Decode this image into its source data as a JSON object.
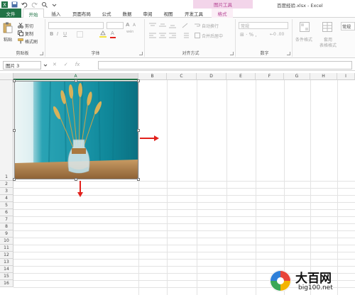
{
  "title_bar": {
    "contextual_tab_group": "图片工具",
    "document_title": "百度经验.xlsx - Excel"
  },
  "tabs": [
    {
      "label": "文件"
    },
    {
      "label": "开始"
    },
    {
      "label": "插入"
    },
    {
      "label": "页面布局"
    },
    {
      "label": "公式"
    },
    {
      "label": "数据"
    },
    {
      "label": "审阅"
    },
    {
      "label": "视图"
    },
    {
      "label": "开发工具"
    },
    {
      "label": "格式"
    }
  ],
  "ribbon": {
    "clipboard": {
      "paste_label": "粘贴",
      "cut_label": "剪切",
      "copy_label": "复制",
      "format_painter_label": "格式刷",
      "group_label": "剪贴板"
    },
    "font": {
      "bold": "B",
      "italic": "I",
      "underline": "U",
      "font_size_grow": "A",
      "font_size_shrink": "A",
      "font_color_letter": "A",
      "wen": "wén",
      "group_label": "字体"
    },
    "alignment": {
      "wrap_text_label": "自动换行",
      "merge_center_label": "合并后居中",
      "group_label": "对齐方式"
    },
    "number": {
      "format_value": "常规",
      "group_label": "数字"
    },
    "styles": {
      "conditional_format_label": "条件格式",
      "table_format_label_1": "套用",
      "table_format_label_2": "表格格式",
      "cell_style_label": "常规"
    }
  },
  "formula_bar": {
    "name_box_value": "图片 3",
    "cancel_glyph": "✕",
    "enter_glyph": "✓",
    "fx_label": "fx"
  },
  "columns": [
    "A",
    "B",
    "C",
    "D",
    "E",
    "F",
    "G",
    "H",
    "I"
  ],
  "rows": [
    "1",
    "2",
    "3",
    "4",
    "5",
    "6",
    "7",
    "8",
    "9",
    "10",
    "11",
    "12",
    "13",
    "14",
    "15",
    "16"
  ],
  "watermark": {
    "brand": "大百网",
    "url": "big100.net"
  },
  "colors": {
    "excel_green": "#217346",
    "picture_tools_pink": "#b54494",
    "annotation_red": "#e2211c"
  }
}
